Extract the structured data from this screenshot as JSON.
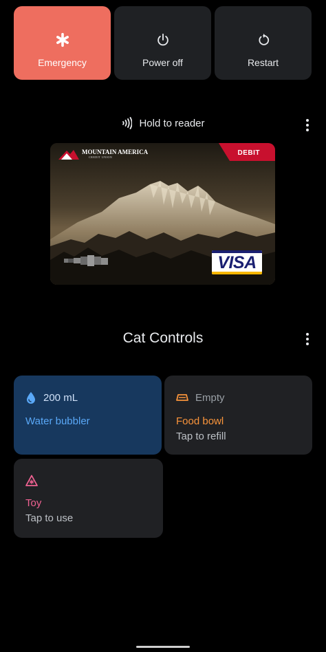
{
  "power_menu": {
    "emergency": {
      "label": "Emergency",
      "icon": "asterisk-icon",
      "color": "#ee6e5f"
    },
    "power_off": {
      "label": "Power off",
      "icon": "power-icon"
    },
    "restart": {
      "label": "Restart",
      "icon": "restart-icon"
    }
  },
  "wallet": {
    "nfc_label": "Hold to reader",
    "nfc_icon": "nfc-icon",
    "more_icon": "more-vert-icon",
    "card": {
      "bank_name": "MOUNTAIN AMERICA",
      "bank_subtitle": "CREDIT UNION",
      "type_tag": "DEBIT",
      "network": "VISA",
      "tag_color": "#c8102e"
    }
  },
  "device_controls": {
    "title": "Cat Controls",
    "more_icon": "more-vert-icon",
    "tiles": [
      {
        "icon": "water-drop-icon",
        "status": "200 mL",
        "title": "Water bubbler",
        "subtitle": "",
        "active": true,
        "accent": "#5aa8f7"
      },
      {
        "icon": "bowl-icon",
        "status": "Empty",
        "title": "Food bowl",
        "subtitle": "Tap to refill",
        "active": false,
        "accent": "#f9943b"
      },
      {
        "icon": "toy-icon",
        "status": "",
        "title": "Toy",
        "subtitle": "Tap to use",
        "active": false,
        "accent": "#f06292"
      }
    ]
  }
}
